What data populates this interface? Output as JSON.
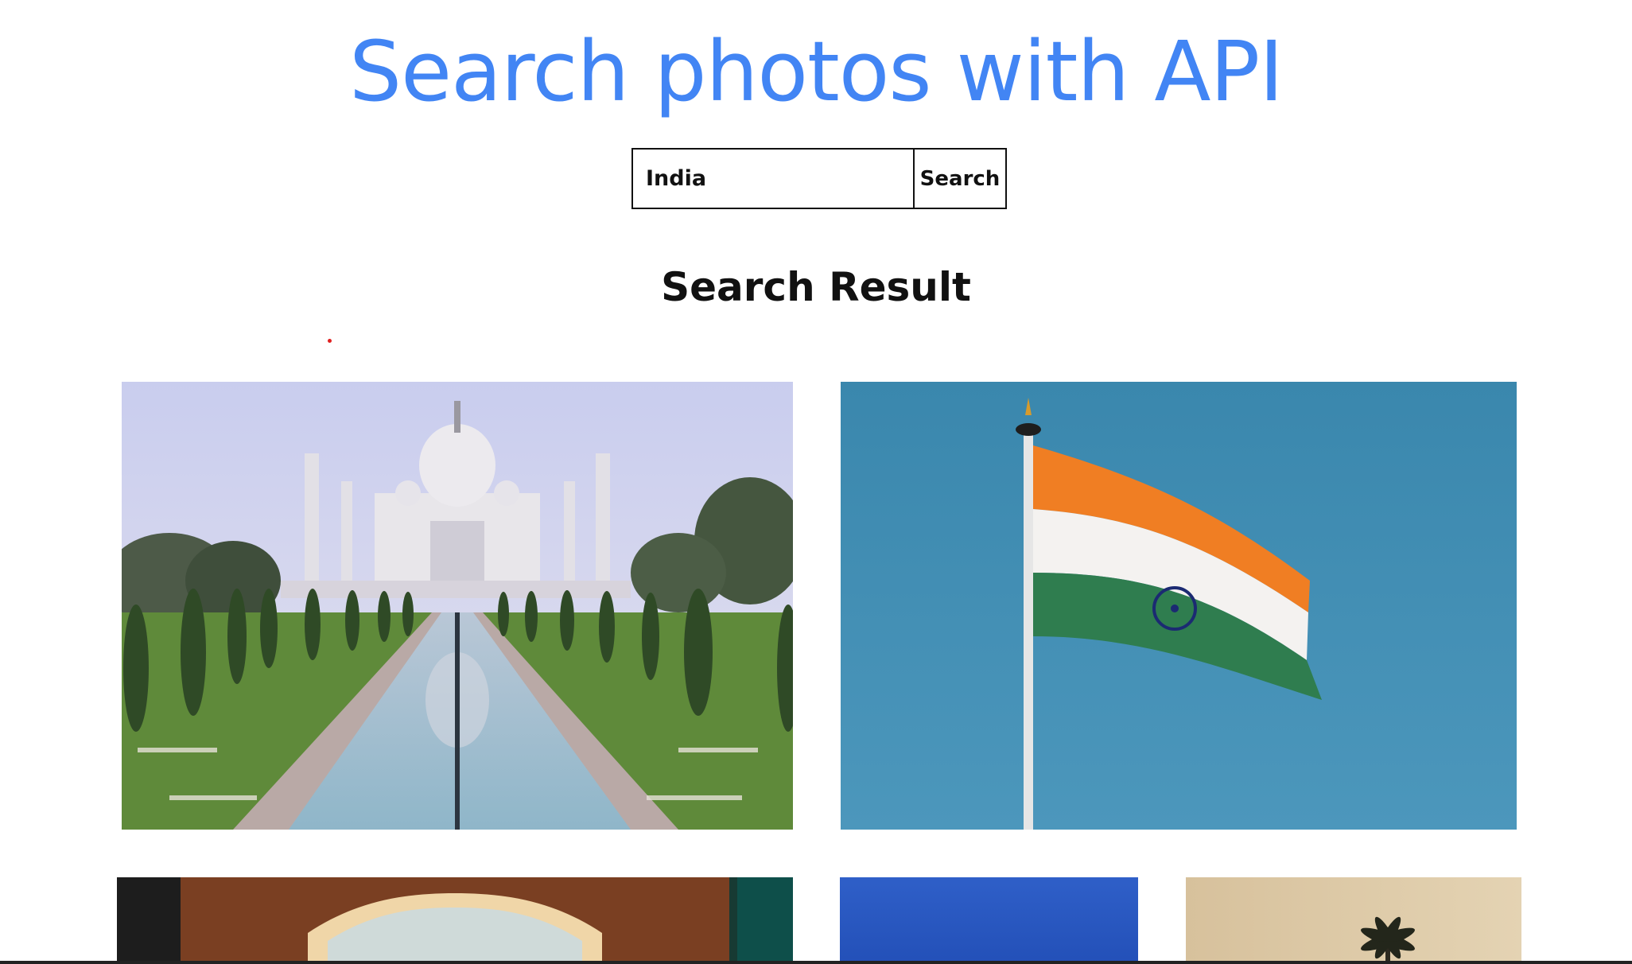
{
  "header": {
    "title": "Search photos with API",
    "accent_color": "#4285f4"
  },
  "search": {
    "value": "India",
    "button_label": "Search"
  },
  "results": {
    "title": "Search Result",
    "photos": [
      {
        "subject": "taj-mahal",
        "icon": "photo-taj-mahal"
      },
      {
        "subject": "india-flag",
        "icon": "photo-india-flag"
      },
      {
        "subject": "arch-doorway",
        "icon": "photo-arch-doorway"
      },
      {
        "subject": "blue-sky",
        "icon": "photo-blue-sky"
      },
      {
        "subject": "palm-tree",
        "icon": "photo-palm-tree"
      }
    ]
  },
  "colors": {
    "text": "#111111",
    "marker": "#e02020"
  }
}
